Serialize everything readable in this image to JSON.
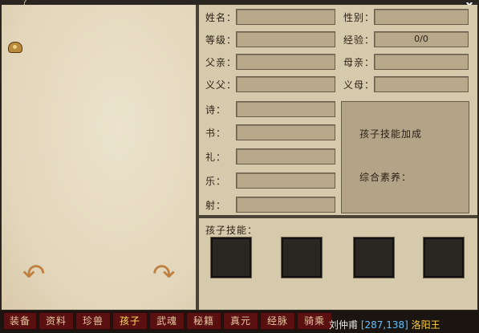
{
  "window": {
    "close_symbol": "x",
    "help_symbol": "?"
  },
  "fields": {
    "name_label": "姓名：",
    "gender_label": "性别：",
    "level_label": "等级：",
    "exp_label": "经验：",
    "exp_value": "0/0",
    "father_label": "父亲：",
    "mother_label": "母亲：",
    "godfather_label": "义父：",
    "godmother_label": "义母：",
    "poetry_label": "诗：",
    "book_label": "书：",
    "etiquette_label": "礼：",
    "music_label": "乐：",
    "archery_label": "射："
  },
  "bonus": {
    "title": "孩子技能加成",
    "total_label": "综合素养："
  },
  "skills": {
    "label": "孩子技能："
  },
  "tabs": [
    "装备",
    "资料",
    "珍兽",
    "孩子",
    "武魂",
    "秘籍",
    "真元",
    "经脉",
    "骑乘"
  ],
  "active_tab": "孩子",
  "statusbar": {
    "name": "刘仲甫",
    "coords": "[287,138]",
    "place": "洛阳王"
  },
  "icons": {
    "bag": "bag-icon",
    "rotate_left": "rotate-left-arrow-icon",
    "rotate_right": "rotate-right-arrow-icon"
  }
}
